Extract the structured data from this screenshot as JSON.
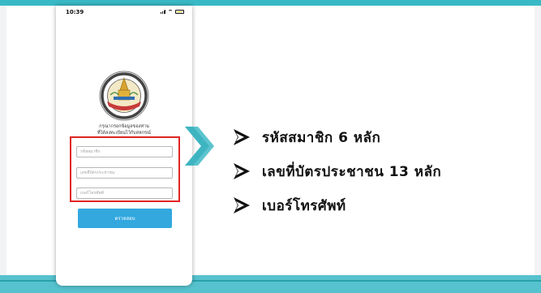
{
  "colors": {
    "accent_teal": "#38b9c6",
    "highlight_red": "#e02525",
    "button_blue": "#32a8df"
  },
  "phone": {
    "status_time": "10:39",
    "seal_logo_icon": "organization-seal",
    "prompt_line1": "กรุณากรอกข้อมูลของท่าน",
    "prompt_line2": "ที่ได้ลงทะเบียนไว้กับสหกรณ์",
    "fields": [
      {
        "placeholder": "รหัสสมาชิก"
      },
      {
        "placeholder": "เลขที่บัตรประชาชน"
      },
      {
        "placeholder": "เบอร์โทรศัพท์"
      }
    ],
    "check_button_label": "ตรวจสอบ"
  },
  "callout_icon": "chevron-right-icon",
  "bullets": [
    {
      "icon": "arrow-bullet-icon",
      "text": "รหัสสมาชิก 6 หลัก"
    },
    {
      "icon": "arrow-bullet-icon",
      "text": "เลขที่บัตรประชาชน 13 หลัก"
    },
    {
      "icon": "arrow-bullet-icon",
      "text": "เบอร์โทรศัพท์"
    }
  ]
}
